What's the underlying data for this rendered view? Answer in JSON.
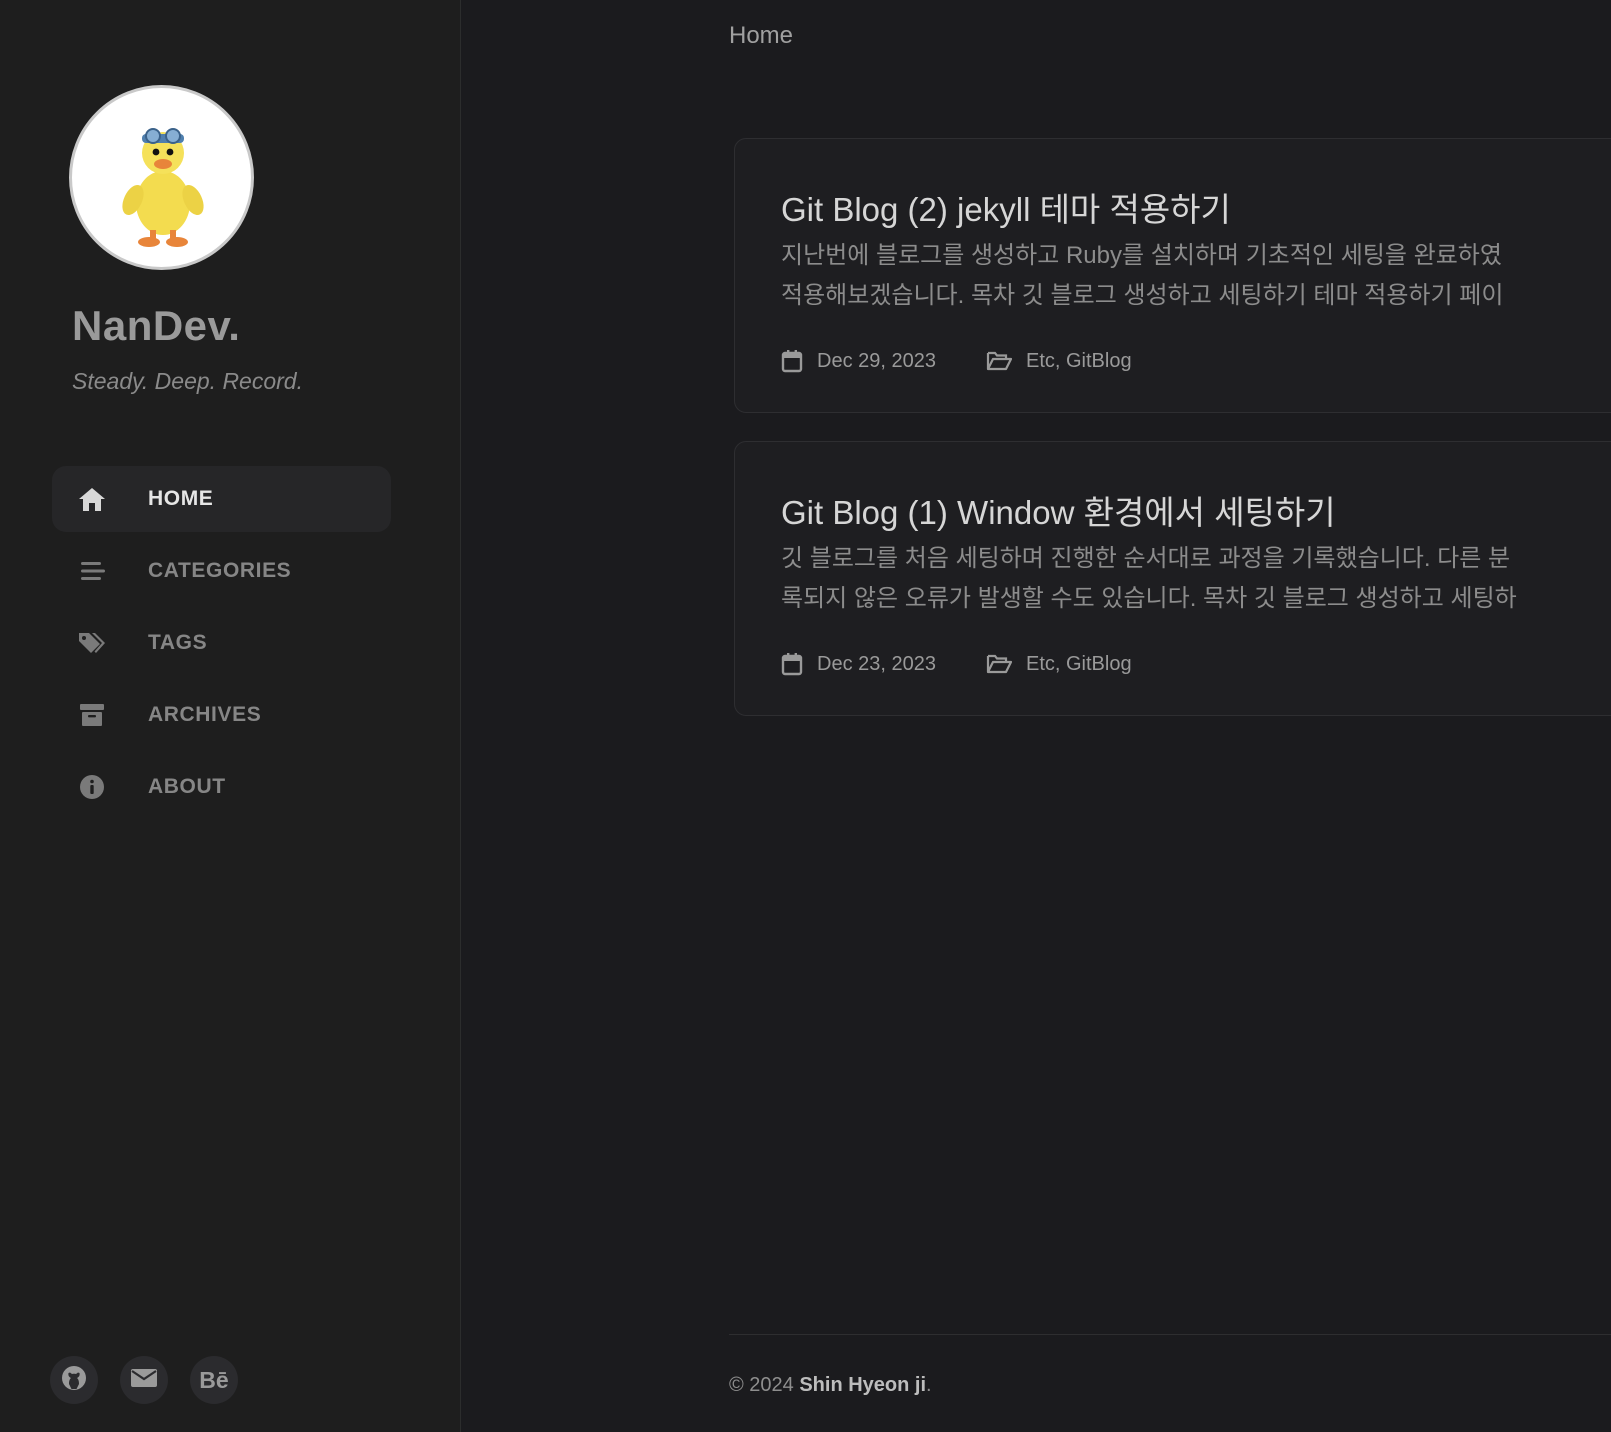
{
  "sidebar": {
    "site_title": "NanDev.",
    "site_subtitle": "Steady. Deep. Record.",
    "nav": [
      {
        "label": "HOME",
        "icon": "home-icon",
        "active": true
      },
      {
        "label": "CATEGORIES",
        "icon": "stream-icon"
      },
      {
        "label": "TAGS",
        "icon": "tags-icon"
      },
      {
        "label": "ARCHIVES",
        "icon": "archive-icon"
      },
      {
        "label": "ABOUT",
        "icon": "info-icon"
      }
    ],
    "social": [
      {
        "icon": "github-icon"
      },
      {
        "icon": "email-icon"
      },
      {
        "icon": "behance-icon",
        "text": "Bē"
      }
    ]
  },
  "main": {
    "breadcrumb": "Home",
    "posts": [
      {
        "title": "Git Blog (2) jekyll 테마 적용하기",
        "excerpt_line1": "지난번에 블로그를 생성하고 Ruby를 설치하며 기초적인 세팅을 완료하였",
        "excerpt_line2": "적용해보겠습니다. 목차 깃 블로그 생성하고 세팅하기 테마 적용하기 페이",
        "date": "Dec 29, 2023",
        "categories": "Etc, GitBlog"
      },
      {
        "title": "Git Blog (1) Window 환경에서 세팅하기",
        "excerpt_line1": "깃 블로그를 처음 세팅하며 진행한 순서대로 과정을 기록했습니다. 다른 분",
        "excerpt_line2": "록되지 않은 오류가 발생할 수도 있습니다. 목차 깃 블로그 생성하고 세팅하",
        "date": "Dec 23, 2023",
        "categories": "Etc, GitBlog"
      }
    ],
    "footer": {
      "prefix": "© 2024 ",
      "author": "Shin Hyeon ji",
      "suffix": "."
    }
  },
  "colors": {
    "background": "#1b1b1e",
    "sidebar_bg": "#1e1e1e",
    "nav_active": "#262628",
    "text_muted": "#868686"
  }
}
